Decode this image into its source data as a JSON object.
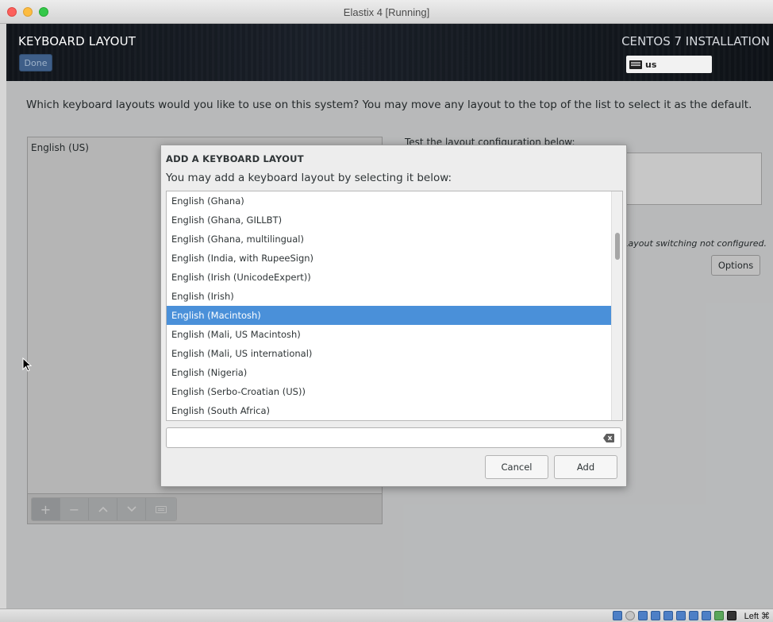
{
  "window": {
    "title": "Elastix 4 [Running]"
  },
  "header": {
    "title": "KEYBOARD LAYOUT",
    "done_label": "Done",
    "install_title": "CENTOS 7 INSTALLATION",
    "keyboard_indicator": "us"
  },
  "main": {
    "question": "Which keyboard layouts would you like to use on this system?  You may move any layout to the top of the list to select it as the default.",
    "layouts": [
      "English (US)"
    ],
    "test_label": "Test the layout configuration below:",
    "switch_note": "Layout switching not configured.",
    "options_label": "Options"
  },
  "dialog": {
    "title": "ADD A KEYBOARD LAYOUT",
    "subtitle": "You may add a keyboard layout by selecting it below:",
    "items": [
      "English (Ghana)",
      "English (Ghana, GILLBT)",
      "English (Ghana, multilingual)",
      "English (India, with RupeeSign)",
      "English (Irish (UnicodeExpert))",
      "English (Irish)",
      "English (Macintosh)",
      "English (Mali, US Macintosh)",
      "English (Mali, US international)",
      "English (Nigeria)",
      "English (Serbo-Croatian (US))",
      "English (South Africa)"
    ],
    "selected_index": 6,
    "search_value": "",
    "cancel_label": "Cancel",
    "add_label": "Add"
  },
  "statusbar": {
    "host_key": "Left ⌘"
  },
  "colors": {
    "selection": "#4a90d9",
    "done_button": "#3e5e88",
    "header_bg": "#141920"
  }
}
